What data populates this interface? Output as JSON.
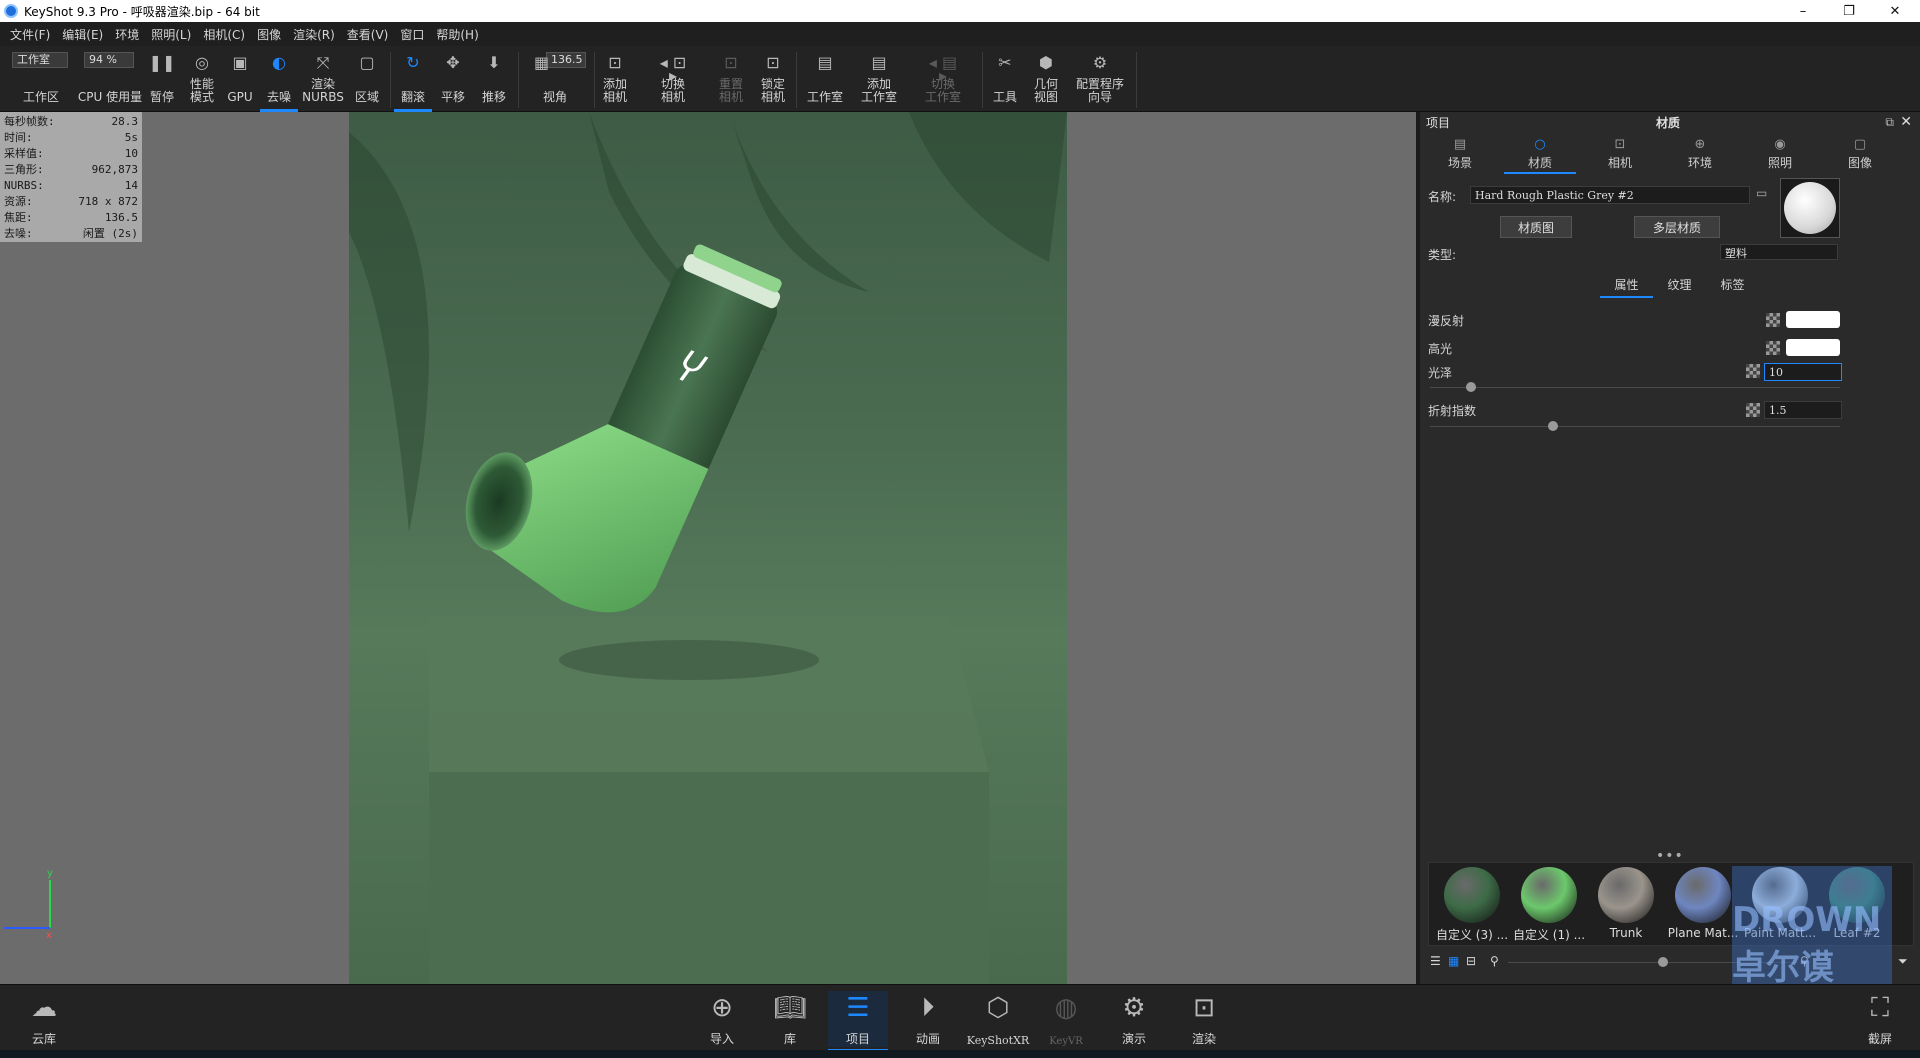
{
  "window": {
    "title": "KeyShot 9.3 Pro  - 呼吸器渲染.bip  - 64 bit",
    "controls": [
      "–",
      "❐",
      "✕"
    ]
  },
  "menu": [
    "文件(F)",
    "编辑(E)",
    "环境",
    "照明(L)",
    "相机(C)",
    "图像",
    "渲染(R)",
    "查看(V)",
    "窗口",
    "帮助(H)"
  ],
  "ribbon": {
    "workspace_combo": "工作室",
    "zoom_combo": "94 %",
    "fov_value": "136.5",
    "buttons": {
      "workspace": "工作区",
      "cpu_usage": "CPU 使用量",
      "pause": "暂停",
      "perf_mode": "性能\n模式",
      "gpu": "GPU",
      "denoise": "去噪",
      "render_nurbs": "渲染\nNURBS",
      "region": "区域",
      "tumble": "翻滚",
      "pan": "平移",
      "dolly": "推移",
      "fov": "视角",
      "add_camera": "添加\n相机",
      "switch_camera": "切换\n相机",
      "reset_camera": "重置\n相机",
      "lock_camera": "锁定\n相机",
      "studio": "工作室",
      "add_studio": "添加\n工作室",
      "switch_studio": "切换\n工作室",
      "tools": "工具",
      "geometry_view": "几何\n视图",
      "config_wizard": "配置程序\n向导"
    }
  },
  "stats": [
    {
      "k": "每秒帧数:",
      "v": "28.3"
    },
    {
      "k": "时间:",
      "v": "5s"
    },
    {
      "k": "采样值:",
      "v": "10"
    },
    {
      "k": "三角形:",
      "v": "962,873"
    },
    {
      "k": "NURBS:",
      "v": "14"
    },
    {
      "k": "资源:",
      "v": "718 x 872"
    },
    {
      "k": "焦距:",
      "v": "136.5"
    },
    {
      "k": "去噪:",
      "v": "闲置 (2s)"
    }
  ],
  "panel": {
    "left_title": "项目",
    "center_title": "材质",
    "tabs": [
      "场景",
      "材质",
      "相机",
      "环境",
      "照明",
      "图像"
    ],
    "name_label": "名称:",
    "name_value": "Hard Rough Plastic Grey #2",
    "btn_material_graph": "材质图",
    "btn_multi_material": "多层材质",
    "type_label": "类型:",
    "type_value": "塑料",
    "subtabs": [
      "属性",
      "纹理",
      "标签"
    ],
    "props": {
      "diffuse": "漫反射",
      "specular": "高光",
      "gloss": "光泽",
      "gloss_value": "10",
      "ior": "折射指数",
      "ior_value": "1.5"
    },
    "gloss_level": 0.1,
    "ior_level": 0.3
  },
  "materials": [
    {
      "name": "自定义 (3) ...",
      "color": "#3d6b47"
    },
    {
      "name": "自定义 (1) ...",
      "color": "#6cc86c"
    },
    {
      "name": "Trunk",
      "color": "#9a948c"
    },
    {
      "name": "Plane Mat...",
      "color": "#6e86c0"
    },
    {
      "name": "Paint Matt...",
      "color": "#cfe0f0"
    },
    {
      "name": "Leaf #2",
      "color": "#3f8a6e"
    }
  ],
  "bottom": [
    "云库",
    "导入",
    "库",
    "项目",
    "动画",
    "KeyShotXR",
    "KeyVR",
    "演示",
    "渲染",
    "截屏"
  ],
  "watermark": "DROWN 卓尔谟",
  "colors": {
    "accent": "#1e88ff",
    "background": "#232323"
  }
}
